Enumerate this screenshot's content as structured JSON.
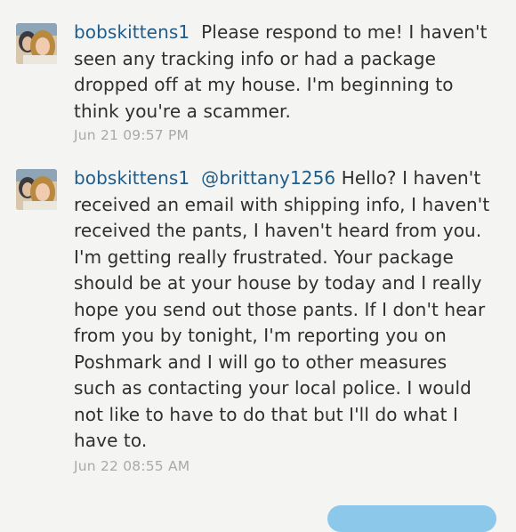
{
  "comments": [
    {
      "username": "bobskittens1",
      "mention": "",
      "message": "Please respond to me! I haven't seen any tracking info or had a package dropped off at my house. I'm beginning to think you're a scammer.",
      "timestamp": "Jun 21 09:57 PM"
    },
    {
      "username": "bobskittens1",
      "mention": "@brittany1256",
      "message": "Hello? I haven't received an email with shipping info, I haven't received the pants, I haven't heard from you. I'm getting really frustrated. Your package should be at your house by today and I really hope you send out those pants. If I don't hear from you by tonight, I'm reporting you on Poshmark and  I will go to other measures such as contacting your local police. I would not like to have to do that but I'll do what I have to.",
      "timestamp": "Jun 22 08:55 AM"
    }
  ],
  "colors": {
    "background": "#f4f4f2",
    "username": "#1f5c8a",
    "text": "#2f2f2f",
    "timestamp": "#a9a9a9",
    "accent_button": "#8cc8ea"
  }
}
